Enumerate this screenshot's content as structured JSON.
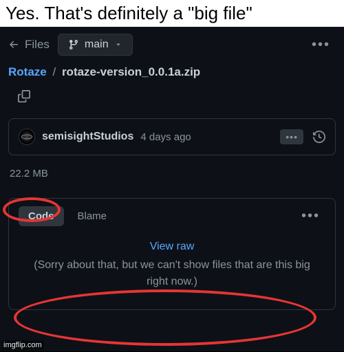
{
  "meme": {
    "caption": "Yes. That's definitely a \"big file\"",
    "watermark": "imgflip.com"
  },
  "nav": {
    "back_label": "Files",
    "branch": "main"
  },
  "breadcrumb": {
    "repo": "Rotaze",
    "separator": "/",
    "file": "rotaze-version_0.0.1a.zip"
  },
  "commit": {
    "author": "semisightStudios",
    "time": "4 days ago",
    "sha": "•••"
  },
  "file": {
    "size": "22.2 MB"
  },
  "tabs": {
    "code": "Code",
    "blame": "Blame"
  },
  "preview": {
    "view_raw": "View raw",
    "message": "(Sorry about that, but we can't show files that are this big right now.)"
  }
}
